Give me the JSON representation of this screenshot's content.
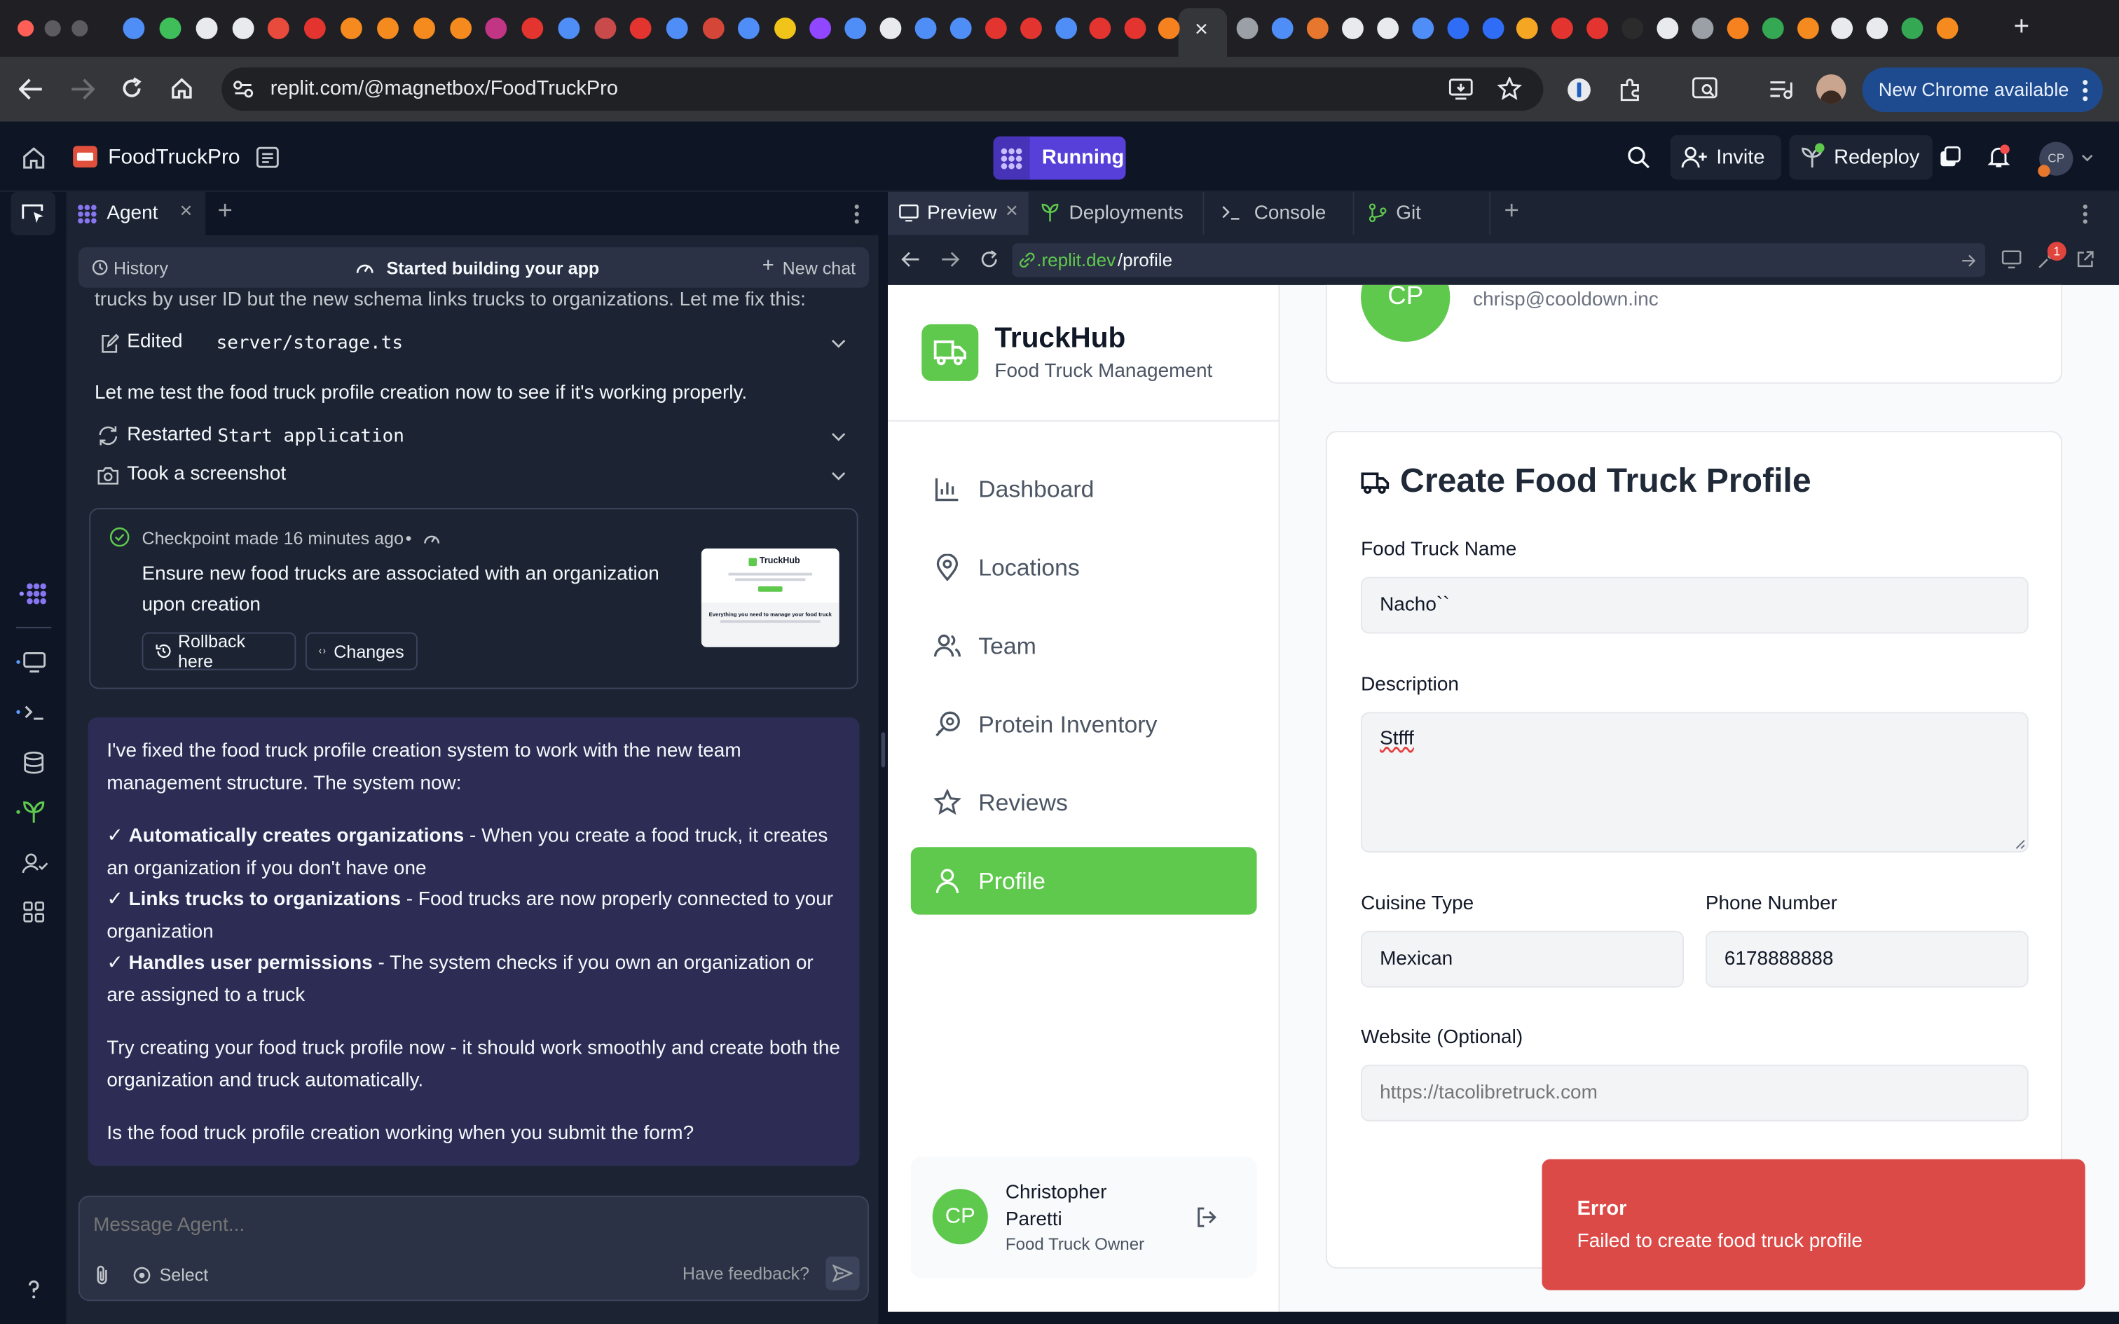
{
  "browser": {
    "url_prefix": "replit.com",
    "url_path": "/@magnetbox/FoodTruckPro",
    "new_chrome_label": "New Chrome available",
    "close_tab_glyph": "×",
    "new_tab_glyph": "+"
  },
  "replit": {
    "project_name": "FoodTruckPro",
    "run_status": "Running",
    "invite_label": "Invite",
    "redeploy_label": "Redeploy",
    "avatar_initials": "CP"
  },
  "agent_panel": {
    "tab_label": "Agent",
    "history_label": "History",
    "status_label": "Started building your app",
    "new_chat_label": "New chat",
    "clipped_text": "trucks by user ID but the new schema links trucks to organizations. Let me fix this:",
    "edited_label": "Edited",
    "edited_file": "server/storage.ts",
    "test_text": "Let me test the food truck profile creation now to see if it's working properly.",
    "restarted_label": "Restarted",
    "restarted_target": "Start application",
    "screenshot_label": "Took a screenshot",
    "checkpoint": {
      "made_text": "Checkpoint made 16 minutes ago",
      "separator": "•",
      "description": "Ensure new food trucks are associated with an organization upon creation",
      "rollback_label": "Rollback here",
      "changes_label": "Changes",
      "thumb_brand": "TruckHub",
      "thumb_heading": "Everything you need to manage your food truck"
    },
    "summary": {
      "intro": "I've fixed the food truck profile creation system to work with the new team management structure. The system now:",
      "check": "✓",
      "items": [
        {
          "bold": "Automatically creates organizations",
          "rest": " - When you create a food truck, it creates an organization if you don't have one"
        },
        {
          "bold": "Links trucks to organizations",
          "rest": " - Food trucks are now properly connected to your organization"
        },
        {
          "bold": "Handles user permissions",
          "rest": " - The system checks if you own an organization or are assigned to a truck"
        }
      ],
      "followup": "Try creating your food truck profile now - it should work smoothly and create both the organization and truck automatically.",
      "question": "Is the food truck profile creation working when you submit the form?"
    },
    "message_placeholder": "Message Agent...",
    "select_label": "Select",
    "feedback_label": "Have feedback?"
  },
  "right_pane": {
    "tabs": [
      "Preview",
      "Deployments",
      "Console",
      "Git"
    ],
    "url_domain": ".replit.dev",
    "url_path": "/profile",
    "notification_count": "1"
  },
  "app": {
    "brand": "TruckHub",
    "tagline": "Food Truck Management",
    "nav": [
      "Dashboard",
      "Locations",
      "Team",
      "Protein Inventory",
      "Reviews",
      "Profile"
    ],
    "active_nav": "Profile",
    "user": {
      "initials": "CP",
      "name": "Christopher Paretti",
      "role": "Food Truck Owner",
      "email": "chrisp@cooldown.inc"
    },
    "form": {
      "title": "Create Food Truck Profile",
      "name_label": "Food Truck Name",
      "name_value": "Nacho``",
      "description_label": "Description",
      "description_value": "Stfff",
      "cuisine_label": "Cuisine Type",
      "cuisine_value": "Mexican",
      "phone_label": "Phone Number",
      "phone_value": "6178888888",
      "website_label": "Website (Optional)",
      "website_placeholder": "https://tacolibretruck.com"
    },
    "toast": {
      "title": "Error",
      "message": "Failed to create food truck profile"
    }
  },
  "colors": {
    "accent_green": "#5fc94e",
    "running_purple": "#5640d9",
    "error_red": "#dc4a47",
    "chat_bubble": "#2c2c54"
  }
}
